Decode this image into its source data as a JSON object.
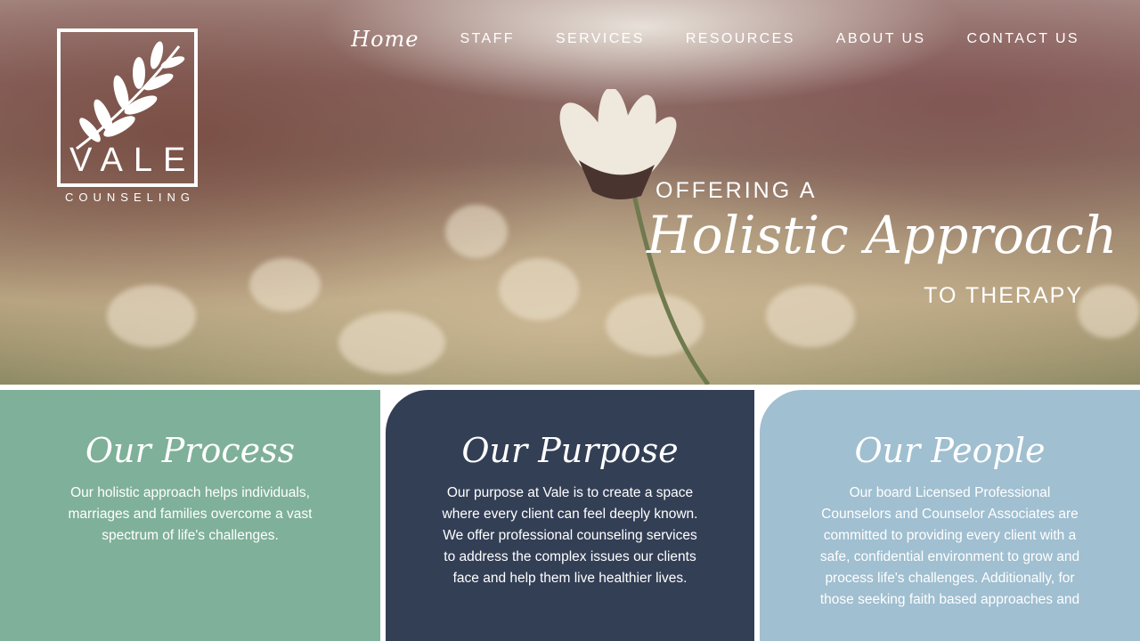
{
  "logo": {
    "word": "VALE",
    "subtitle": "COUNSELING"
  },
  "nav": {
    "items": [
      {
        "label": "Home"
      },
      {
        "label": "STAFF"
      },
      {
        "label": "SERVICES"
      },
      {
        "label": "RESOURCES"
      },
      {
        "label": "ABOUT US"
      },
      {
        "label": "CONTACT US"
      }
    ]
  },
  "hero": {
    "line1": "OFFERING A",
    "line2": "Holistic Approach",
    "line3": "TO THERAPY"
  },
  "panels": [
    {
      "title": "Our Process",
      "text": "Our holistic approach helps individuals, marriages and families overcome a vast spectrum of life's challenges.",
      "color": "#7fb099"
    },
    {
      "title": "Our Purpose",
      "text": "Our purpose at Vale is to create a space where every client can feel deeply known. We offer professional counseling services to address the complex issues our clients face and help them live healthier lives.",
      "color": "#333f55"
    },
    {
      "title": "Our People",
      "text": "Our board Licensed Professional Counselors and Counselor Associates are committed to providing every client with a safe, confidential environment to grow and process life's challenges. Additionally, for those seeking faith based approaches and",
      "color": "#a0bfd0"
    }
  ]
}
